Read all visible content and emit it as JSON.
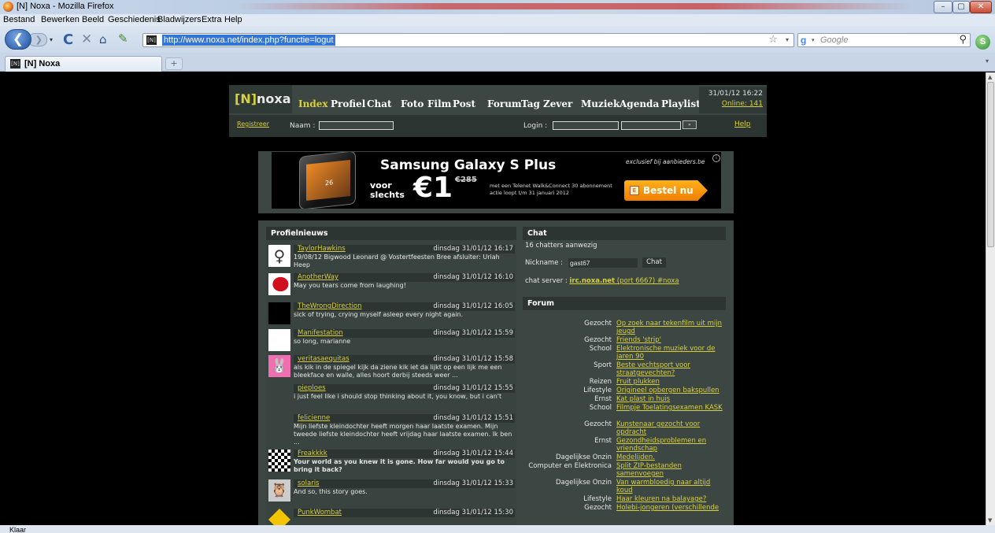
{
  "window": {
    "title": "[N] Noxa - Mozilla Firefox",
    "min": "–",
    "max": "▢",
    "close": "✕"
  },
  "menu": [
    "Bestand",
    "Bewerken",
    "Beeld",
    "Geschiedenis",
    "Bladwijzers",
    "Extra",
    "Help"
  ],
  "toolbar": {
    "back": "❮",
    "forward": "❯",
    "history_dropdown": "▾",
    "reload": "C",
    "stop": "✕",
    "home": "⌂",
    "bookmark": "✎",
    "url": "http://www.noxa.net/index.php?functie=logut",
    "url_favicon": "[N]",
    "star": "☆",
    "url_dropdown": "▾",
    "search_engine": "g",
    "search_dropdown": "▾",
    "search_placeholder": "Google",
    "search_btn": "⚲",
    "addon": "S"
  },
  "tabs": {
    "active": "[N] Noxa",
    "favicon": "[N]",
    "new_tab": "+",
    "list": "▾"
  },
  "status": "Klaar",
  "scroll": {
    "up": "▲",
    "down": "▼"
  },
  "site": {
    "logo_bracket": "[N]",
    "logo_text": "noxa",
    "nav": [
      "Index",
      "Profiel",
      "Chat",
      "Foto",
      "Film",
      "Post",
      "Forum",
      "Tag",
      "Zever",
      "Muziek",
      "Agenda",
      "Playlist"
    ],
    "active_nav": "Index",
    "datetime": "31/01/12 16:22",
    "online": "Online: 141",
    "registreer": "Registreer",
    "naam_label": "Naam :",
    "login_label": "Login :",
    "login_submit": "»",
    "help": "Help"
  },
  "ad": {
    "headline": "Samsung Galaxy S Plus",
    "voor": "voor",
    "slechts": "slechts",
    "price": "€1",
    "old_price": "€285",
    "small_line1": "met een Telenet Walk&Connect 30 abonnement",
    "small_line2": "actie loopt t/m 31 januari 2012",
    "exclusive": "exclusief bij aanbieders.be",
    "info": "i",
    "cta": "Bestel nu",
    "cta_icon": "E",
    "phone_screen": "26"
  },
  "profielnieuws": {
    "title": "Profielnieuws",
    "items": [
      {
        "name": "TaylorHawkins",
        "date": "dinsdag 31/01/12 16:17",
        "msg": "19/08/12 Bigwood Leonard @ Vostertfeesten Bree afsluiter: Uriah Heep",
        "bold": false,
        "avatar": "stick",
        "avatar_label": "♀"
      },
      {
        "name": "AnotherWay",
        "date": "dinsdag 31/01/12 16:10",
        "msg": "May you tears come from laughing!",
        "bold": false,
        "avatar": "lips",
        "avatar_label": ""
      },
      {
        "name": "TheWrongDirection",
        "date": "dinsdag 31/01/12 16:05",
        "msg": "sick of trying, crying myself asleep every night again.",
        "bold": false,
        "avatar": "black",
        "avatar_label": ""
      },
      {
        "name": "Manifestation",
        "date": "dinsdag 31/01/12 15:59",
        "msg": "so long, marianne",
        "bold": false,
        "avatar": "white",
        "avatar_label": ""
      },
      {
        "name": "veritasaequitas",
        "date": "dinsdag 31/01/12 15:58",
        "msg": "als kik in de spiegel kijk da ziene kik iet da lijkt op een lijk me een bleekface en walle, alles hoort derbij steeds weer ...",
        "bold": false,
        "avatar": "bunny",
        "avatar_label": "🐰"
      },
      {
        "name": "pieploes",
        "date": "dinsdag 31/01/12 15:55",
        "msg": "i just feel like i should stop thinking about it, you know, but i can't",
        "bold": false,
        "avatar": "none",
        "avatar_label": ""
      },
      {
        "name": "felicienne",
        "date": "dinsdag 31/01/12 15:51",
        "msg": "Mijn liefste kleindochter heeft morgen haar laatste examen. Mijn tweede liefste kleindochter heeft vrijdag haar laatste examen. Ik ben ...",
        "bold": false,
        "avatar": "none",
        "avatar_label": ""
      },
      {
        "name": "Freakkkk",
        "date": "dinsdag 31/01/12 15:44",
        "msg": "Your world as you knew it is gone. How far would you go to bring it back?",
        "bold": true,
        "avatar": "checker",
        "avatar_label": ""
      },
      {
        "name": "solaris",
        "date": "dinsdag 31/01/12 15:33",
        "msg": "And so, this story goes.",
        "bold": false,
        "avatar": "owl",
        "avatar_label": "🦉"
      },
      {
        "name": "PunkWombat",
        "date": "dinsdag 31/01/12 15:30",
        "msg": "",
        "bold": false,
        "avatar": "sign",
        "avatar_label": ""
      }
    ]
  },
  "chat": {
    "title": "Chat",
    "count": "16 chatters aanwezig",
    "nick_label": "Nickname :",
    "nick_value": "gast67",
    "button": "Chat",
    "server_label": "chat server :",
    "server_link": "irc.noxa.net",
    "server_rest": " (port 6667) #noxa"
  },
  "forum": {
    "title": "Forum",
    "rows": [
      {
        "cat": "Gezocht",
        "title": "Op zoek naar tekenfilm uit mijn jeugd",
        "lines": 2
      },
      {
        "cat": "Gezocht",
        "title": "Friends 'strip'",
        "lines": 1
      },
      {
        "cat": "School",
        "title": "Elektronische muziek voor de jaren 90",
        "lines": 2
      },
      {
        "cat": "Sport",
        "title": "Beste vechtsport voor straatgevechten?",
        "lines": 2
      },
      {
        "cat": "Reizen",
        "title": "Fruit plukken",
        "lines": 1
      },
      {
        "cat": "Lifestyle",
        "title": "Origineel opbergen bakspullen",
        "lines": 1
      },
      {
        "cat": "Ernst",
        "title": "Kat plast in huis",
        "lines": 1
      },
      {
        "cat": "School",
        "title": "Filmpje Toelatingsexamen KASK",
        "lines": 2
      },
      {
        "cat": "Gezocht",
        "title": "Kunstenaar gezocht voor opdracht",
        "lines": 2
      },
      {
        "cat": "Ernst",
        "title": "Gezondheidsproblemen en vriendschap",
        "lines": 2
      },
      {
        "cat": "Dagelijkse Onzin",
        "title": "Medelijden.",
        "lines": 1
      },
      {
        "cat": "Computer en Elektronica",
        "title": "Split ZIP-bestanden samenvoegen",
        "lines": 2
      },
      {
        "cat": "Dagelijkse Onzin",
        "title": "Van warmbloedig naar altijd koud",
        "lines": 2
      },
      {
        "cat": "Lifestyle",
        "title": "Haar kleuren na balayage?",
        "lines": 1
      },
      {
        "cat": "Gezocht",
        "title": "Holebi-jongeren (verschillende",
        "lines": 1
      }
    ]
  },
  "colors": {
    "accent": "#d8cf3e",
    "panel": "#3c4743",
    "panel_dark": "#2c3531",
    "page_bg": "#000000"
  }
}
